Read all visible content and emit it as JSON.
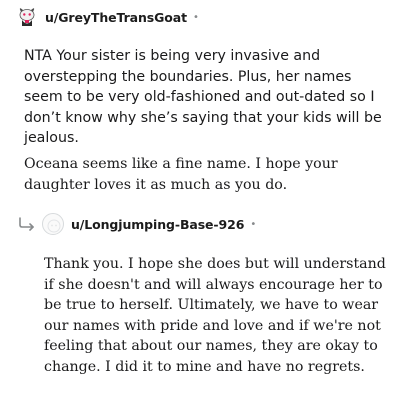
{
  "comments": [
    {
      "username": "u/GreyTheTransGoat",
      "separator": "•",
      "avatar_icon": "goat-snoo-avatar-icon",
      "paragraphs": [
        "NTA Your sister is being very invasive and overstepping the boundaries. Plus, her names seem to be very old-fashioned and out-dated so I don’t know why she’s saying that your kids will be jealous.",
        "Oceana seems like a fine name. I hope your daughter loves it as much as you do."
      ]
    },
    {
      "username": "u/Longjumping-Base-926",
      "separator": "•",
      "avatar_icon": "default-snoo-avatar-icon",
      "reply_icon": "reply-arrow-icon",
      "paragraphs": [
        "Thank you. I hope she does but will understand if she doesn't and will always encourage her to be true to herself. Ultimately, we have to wear our names with pride and love and if we're not feeling that about our names, they are okay to change. I did it to mine and have no regrets."
      ]
    }
  ],
  "colors": {
    "text": "#1a1a1b",
    "muted": "#878a8c",
    "reply_arrow": "#878a8c"
  }
}
